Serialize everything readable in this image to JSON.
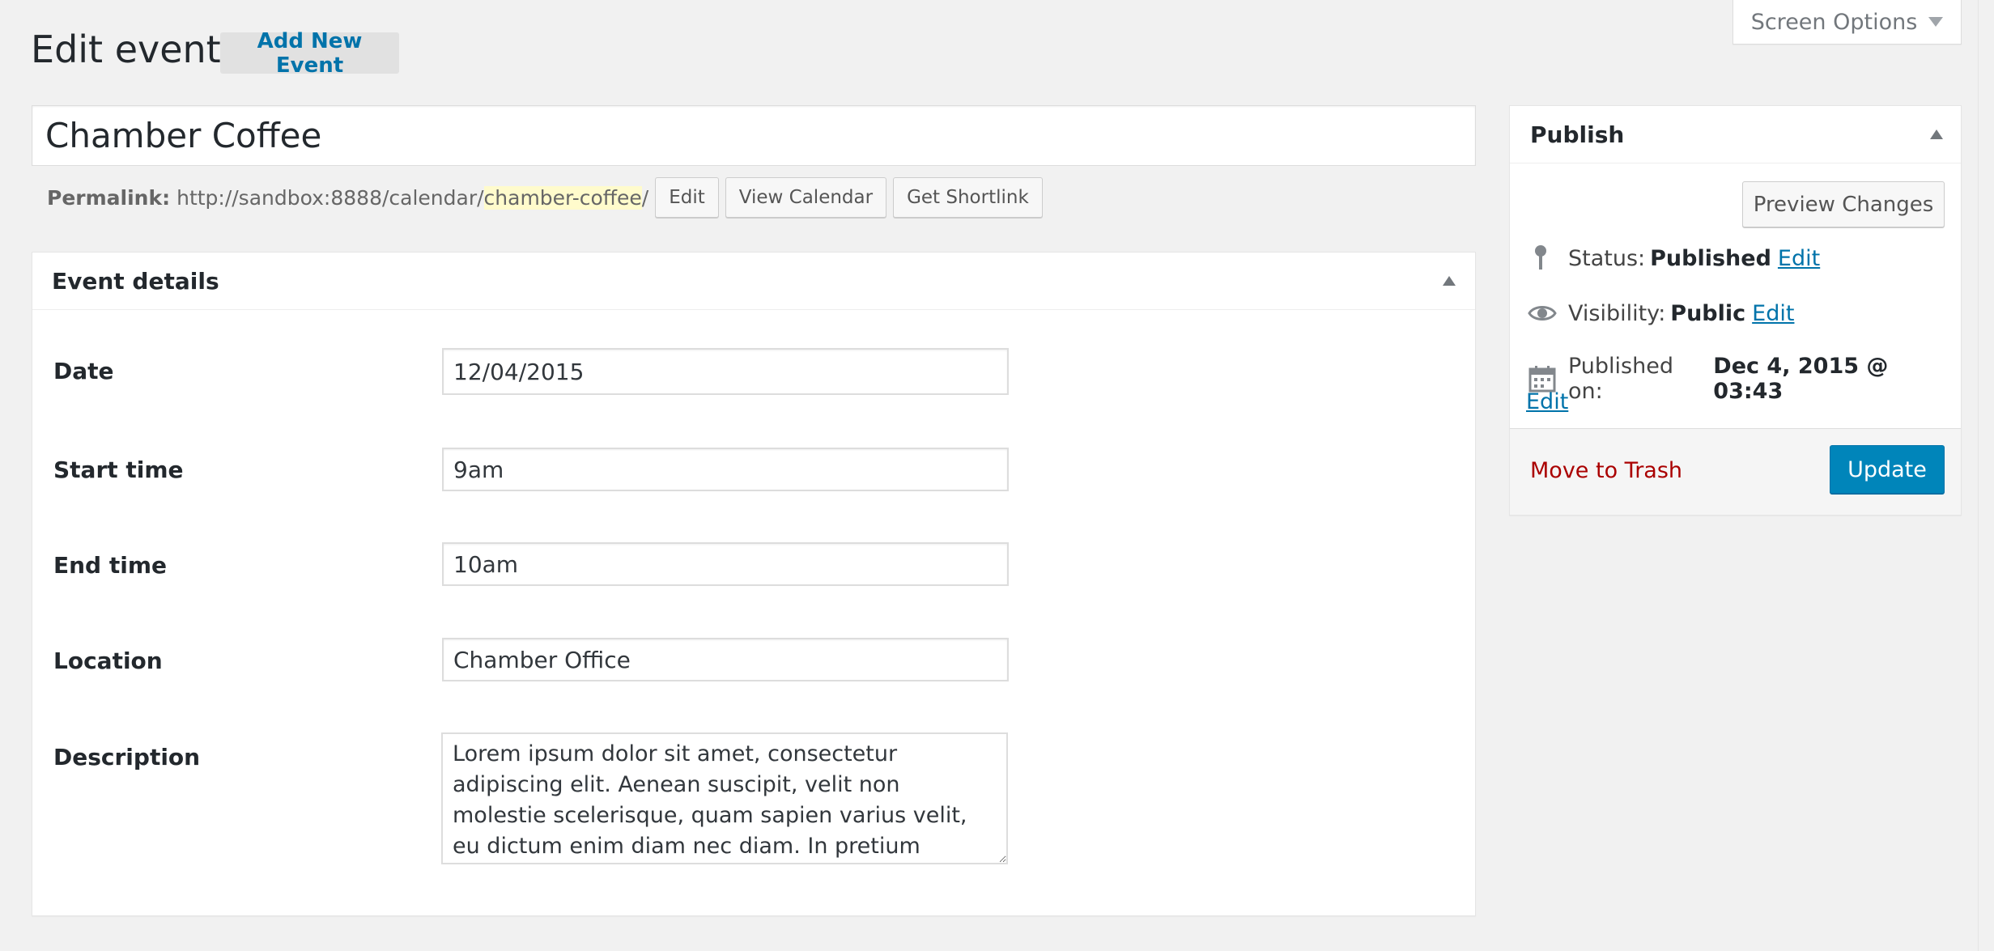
{
  "header": {
    "title": "Edit event",
    "add_new_label": "Add New Event",
    "screen_options_label": "Screen Options"
  },
  "post": {
    "title": "Chamber Coffee",
    "permalink_label": "Permalink:",
    "permalink_base": "http://sandbox:8888/calendar/",
    "permalink_slug": "chamber-coffee",
    "permalink_trailing": "/",
    "edit_label": "Edit",
    "view_calendar_label": "View Calendar",
    "get_shortlink_label": "Get Shortlink"
  },
  "event_details": {
    "heading": "Event details",
    "fields": [
      {
        "label": "Date",
        "value": "12/04/2015"
      },
      {
        "label": "Start time",
        "value": "9am"
      },
      {
        "label": "End time",
        "value": "10am"
      },
      {
        "label": "Location",
        "value": "Chamber Office"
      },
      {
        "label": "Description",
        "value": "Lorem ipsum dolor sit amet, consectetur adipiscing elit. Aenean suscipit, velit non molestie scelerisque, quam sapien varius velit, eu dictum enim diam nec diam. In pretium porttitor metus quis aliquam. Sed"
      }
    ]
  },
  "publish": {
    "heading": "Publish",
    "preview_label": "Preview Changes",
    "status_label": "Status:",
    "status_value": "Published",
    "visibility_label": "Visibility:",
    "visibility_value": "Public",
    "published_on_label": "Published on:",
    "published_on_value": "Dec 4, 2015 @ 03:43",
    "edit_link": "Edit",
    "trash_label": "Move to Trash",
    "update_label": "Update"
  },
  "icons": [
    "pin-icon",
    "eye-icon",
    "calendar-icon",
    "chevron-down-icon",
    "collapse-arrow-icon"
  ],
  "colors": {
    "accent": "#0073aa",
    "primary_button": "#0085ba",
    "trash": "#aa0000",
    "slug_highlight": "#fffbcc",
    "background": "#f1f1f1"
  }
}
